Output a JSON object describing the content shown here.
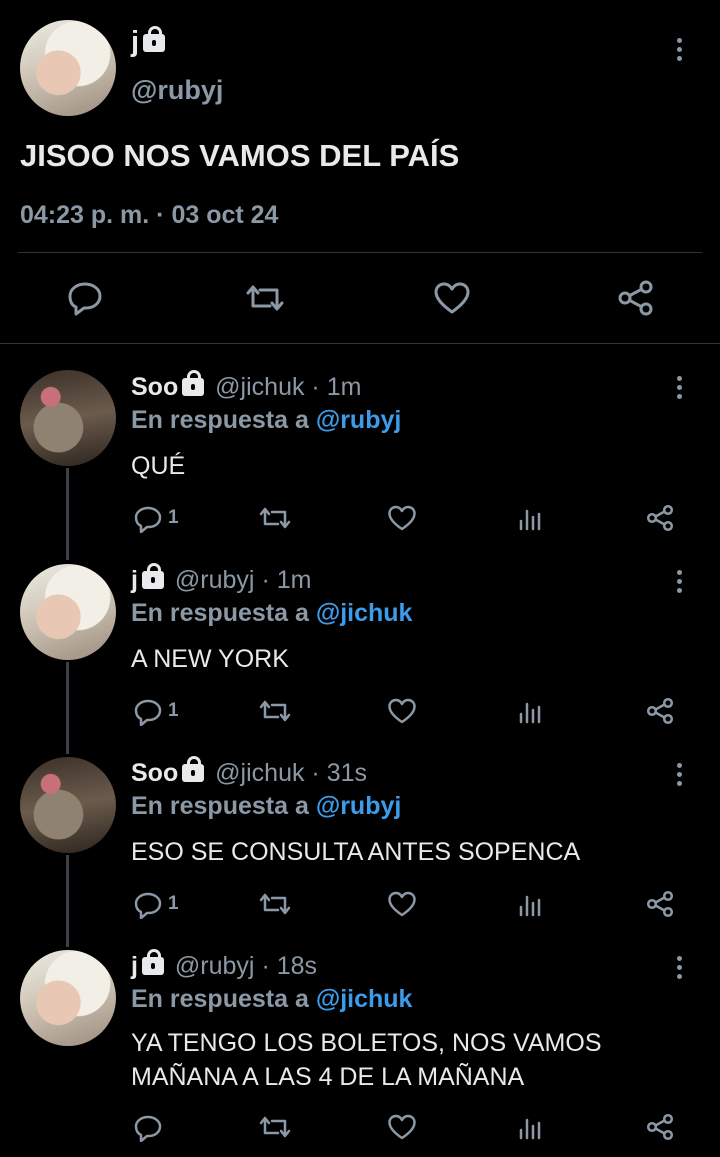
{
  "main": {
    "name": "j",
    "handle": "@rubyj",
    "text": "JISOO NOS VAMOS DEL PAÍS",
    "timestamp": "04:23 p. m. · 03 oct 24"
  },
  "replies": [
    {
      "name": "Soo",
      "handle": "@jichuk",
      "time": "· 1m",
      "reply_prefix": "En respuesta a ",
      "reply_to": "@rubyj",
      "text": "QUÉ",
      "reply_count": "1"
    },
    {
      "name": "j",
      "handle": "@rubyj",
      "time": "· 1m",
      "reply_prefix": "En respuesta a ",
      "reply_to": "@jichuk",
      "text": "A NEW YORK",
      "reply_count": "1"
    },
    {
      "name": "Soo",
      "handle": "@jichuk",
      "time": "· 31s",
      "reply_prefix": "En respuesta a ",
      "reply_to": "@rubyj",
      "text": "ESO SE CONSULTA ANTES SOPENCA",
      "reply_count": "1"
    },
    {
      "name": "j",
      "handle": "@rubyj",
      "time": "· 18s",
      "reply_prefix": "En respuesta a ",
      "reply_to": "@jichuk",
      "text": "YA TENGO LOS BOLETOS, NOS VAMOS\nMAÑANA A LAS 4 DE LA MAÑANA",
      "reply_count": ""
    }
  ],
  "icons": {
    "reply": "reply-icon",
    "retweet": "retweet-icon",
    "like": "heart-icon",
    "views": "views-icon",
    "share": "share-icon",
    "more": "more-icon",
    "lock": "lock-icon"
  },
  "colors": {
    "background": "#000000",
    "text": "#e7e9ea",
    "muted": "#8b98a5",
    "mention": "#3d9be9"
  }
}
